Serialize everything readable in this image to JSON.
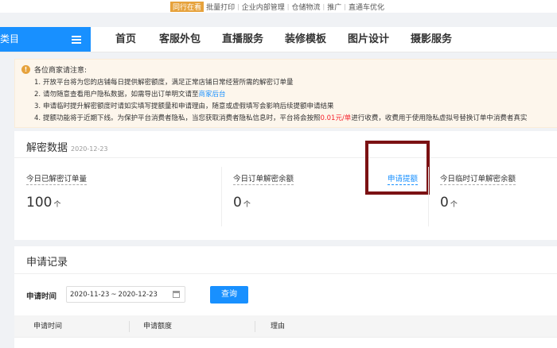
{
  "top_links": [
    "同行在看",
    "批量打印",
    "企业内部管理",
    "仓储物流",
    "推广",
    "直通车优化"
  ],
  "nav": {
    "logo_label": "类目",
    "items": [
      "首页",
      "客服外包",
      "直播服务",
      "装修模板",
      "图片设计",
      "摄影服务"
    ]
  },
  "notice": {
    "title": "各位商家请注意:",
    "lines": [
      {
        "num": "1.",
        "text": "开放平台将为您的店铺每日提供解密额度，满足正常店铺日常经营所需的解密订单量"
      },
      {
        "num": "2.",
        "text": "请勿随意查看用户隐私数据，如需导出订单明文请至",
        "link": "商家后台"
      },
      {
        "num": "3.",
        "text": "申请临时提升解密额度时请如实填写提额量和申请理由，随意或虚假填写会影响后续提额申请结果"
      },
      {
        "num": "4.",
        "pre": "提额功能将于近期下线。为保护平台消费者隐私，当您获取消费者隐私信息时，平台将会按照",
        "red": "0.01元/单",
        "post": "进行收费，收费用于使用隐私虚拟号替换订单中消费者真实"
      }
    ]
  },
  "decrypt": {
    "title": "解密数据",
    "date": "2020-12-23",
    "stats": [
      {
        "label": "今日已解密订单量",
        "value": "100",
        "unit": "个"
      },
      {
        "label": "今日订单解密余额",
        "value": "0",
        "unit": "个"
      },
      {
        "label": "今日临时订单解密余额",
        "value": "0",
        "unit": "个"
      }
    ],
    "apply_link": "申请提额"
  },
  "records": {
    "title": "申请记录",
    "filter_label": "申请时间",
    "date_start": "2020-11-23",
    "date_sep": "~",
    "date_end": "2020-12-23",
    "query_button": "查询",
    "columns": [
      "申请时间",
      "申请额度",
      "理由"
    ]
  },
  "colors": {
    "accent": "#1890ff",
    "highlight_box": "#7b1113",
    "warning": "#e6a23c",
    "price_red": "#f5222d"
  }
}
